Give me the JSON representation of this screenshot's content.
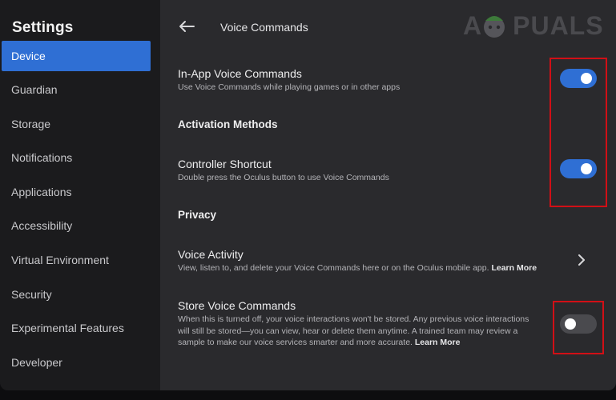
{
  "sidebar": {
    "title": "Settings",
    "items": [
      {
        "label": "Device",
        "active": true
      },
      {
        "label": "Guardian"
      },
      {
        "label": "Storage"
      },
      {
        "label": "Notifications"
      },
      {
        "label": "Applications"
      },
      {
        "label": "Accessibility"
      },
      {
        "label": "Virtual Environment"
      },
      {
        "label": "Security"
      },
      {
        "label": "Experimental Features"
      },
      {
        "label": "Developer"
      }
    ]
  },
  "header": {
    "back_icon": "arrow-left-icon",
    "title": "Voice Commands"
  },
  "watermark": {
    "text_a": "A",
    "text_rest": "PUALS"
  },
  "settings": {
    "in_app": {
      "title": "In-App Voice Commands",
      "desc": "Use Voice Commands while playing games or in other apps",
      "enabled": true
    },
    "activation_heading": "Activation Methods",
    "controller_shortcut": {
      "title": "Controller Shortcut",
      "desc": "Double press the Oculus button to use Voice Commands",
      "enabled": true
    },
    "privacy_heading": "Privacy",
    "voice_activity": {
      "title": "Voice Activity",
      "desc": "View, listen to, and delete your Voice Commands here or on the Oculus mobile app.",
      "learn_more": "Learn More",
      "icon": "chevron-right-icon"
    },
    "store_voice": {
      "title": "Store Voice Commands",
      "desc_line1": "When this is turned off, your voice interactions won't be stored. Any previous voice interactions",
      "desc_line2": "will still be stored—you can view, hear or delete them anytime. A trained team may review a",
      "desc_line3": "sample to make our voice services smarter and more accurate.",
      "learn_more": "Learn More",
      "enabled": false
    }
  },
  "colors": {
    "accent": "#2f6fd4",
    "highlight": "#d10f16",
    "panel": "#2a2a2d",
    "sidebar": "#1b1b1d"
  }
}
